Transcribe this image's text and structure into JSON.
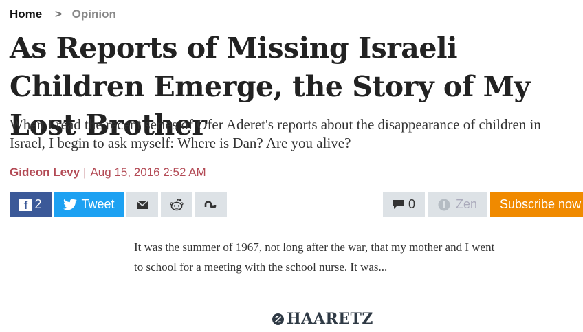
{
  "breadcrumb": {
    "home": "Home",
    "separator": ">",
    "section": "Opinion"
  },
  "article": {
    "title": "As Reports of Missing Israeli Children Emerge, the Story of My Lost Brother",
    "subtitle": "When I read the recent series of Ofer Aderet's reports about the disappearance of children in Israel, I begin to ask myself: Where is Dan? Are you alive?",
    "author": "Gideon Levy",
    "separator": "|",
    "date": "Aug 15, 2016 2:52 AM",
    "excerpt": "It was the summer of 1967, not long after the war, that my mother and I went to school for a meeting with the school nurse. It was..."
  },
  "share": {
    "facebook_glyph": "f",
    "facebook_count": "2",
    "twitter_label": "Tweet",
    "comments_count": "0",
    "zen_label": "Zen",
    "subscribe_label": "Subscribe now"
  },
  "brand": {
    "logo_text": "HAARETZ"
  },
  "colors": {
    "facebook": "#3b5998",
    "twitter": "#1da1f2",
    "subscribe": "#f08a00",
    "author": "#b34a55"
  }
}
